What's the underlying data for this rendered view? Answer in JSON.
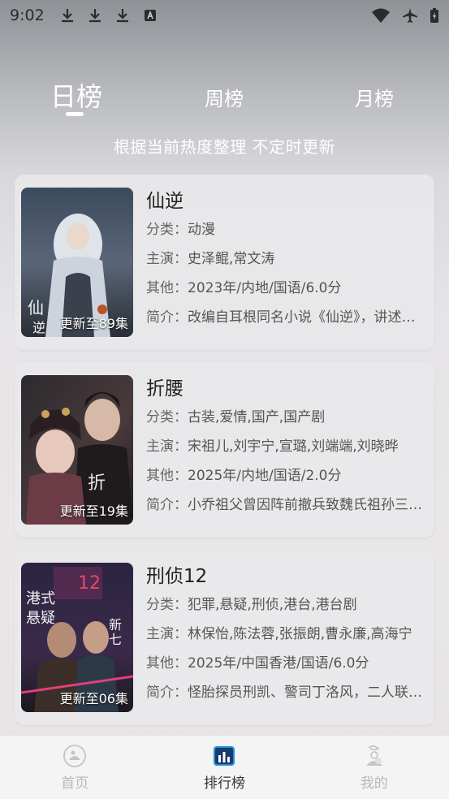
{
  "status_bar": {
    "time": "9:02",
    "left_icons": [
      "download-icon",
      "download-icon",
      "download-icon",
      "a-icon"
    ],
    "right_icons": [
      "wifi-icon",
      "airplane-icon",
      "battery-icon"
    ]
  },
  "tabs": [
    {
      "label": "日榜",
      "active": true
    },
    {
      "label": "周榜",
      "active": false
    },
    {
      "label": "月榜",
      "active": false
    }
  ],
  "subtitle": "根据当前热度整理 不定时更新",
  "labels": {
    "category": "分类：",
    "cast": "主演：",
    "other": "其他：",
    "intro": "简介："
  },
  "items": [
    {
      "title": "仙逆",
      "badge": "更新至89集",
      "category": "动漫",
      "cast": "史泽鲲,常文涛",
      "other": "2023年/内地/国语/6.0分",
      "intro": "改编自耳根同名小说《仙逆》，讲述了乡村平凡少年王林以心中之执念，逆仙而修"
    },
    {
      "title": "折腰",
      "badge": "更新至19集",
      "category": "古装,爱情,国产,国产剧",
      "cast": "宋祖儿,刘宇宁,宣璐,刘端端,刘晓晔",
      "other": "2025年/内地/国语/2.0分",
      "intro": "小乔祖父曾因阵前撤兵致魏氏祖孙三代战死"
    },
    {
      "title": "刑侦12",
      "badge": "更新至06集",
      "category": "犯罪,悬疑,刑侦,港台,港台剧",
      "cast": "林保怡,陈法蓉,张振朗,曹永廉,高海宁",
      "other": "2025年/中国香港/国语/6.0分",
      "intro": "怪胎探员刑凯、警司丁洛风，二人联手破案"
    }
  ],
  "bottom_nav": [
    {
      "label": "首页",
      "icon": "home-icon",
      "active": false
    },
    {
      "label": "排行榜",
      "icon": "ranking-icon",
      "active": true
    },
    {
      "label": "我的",
      "icon": "profile-icon",
      "active": false
    }
  ]
}
